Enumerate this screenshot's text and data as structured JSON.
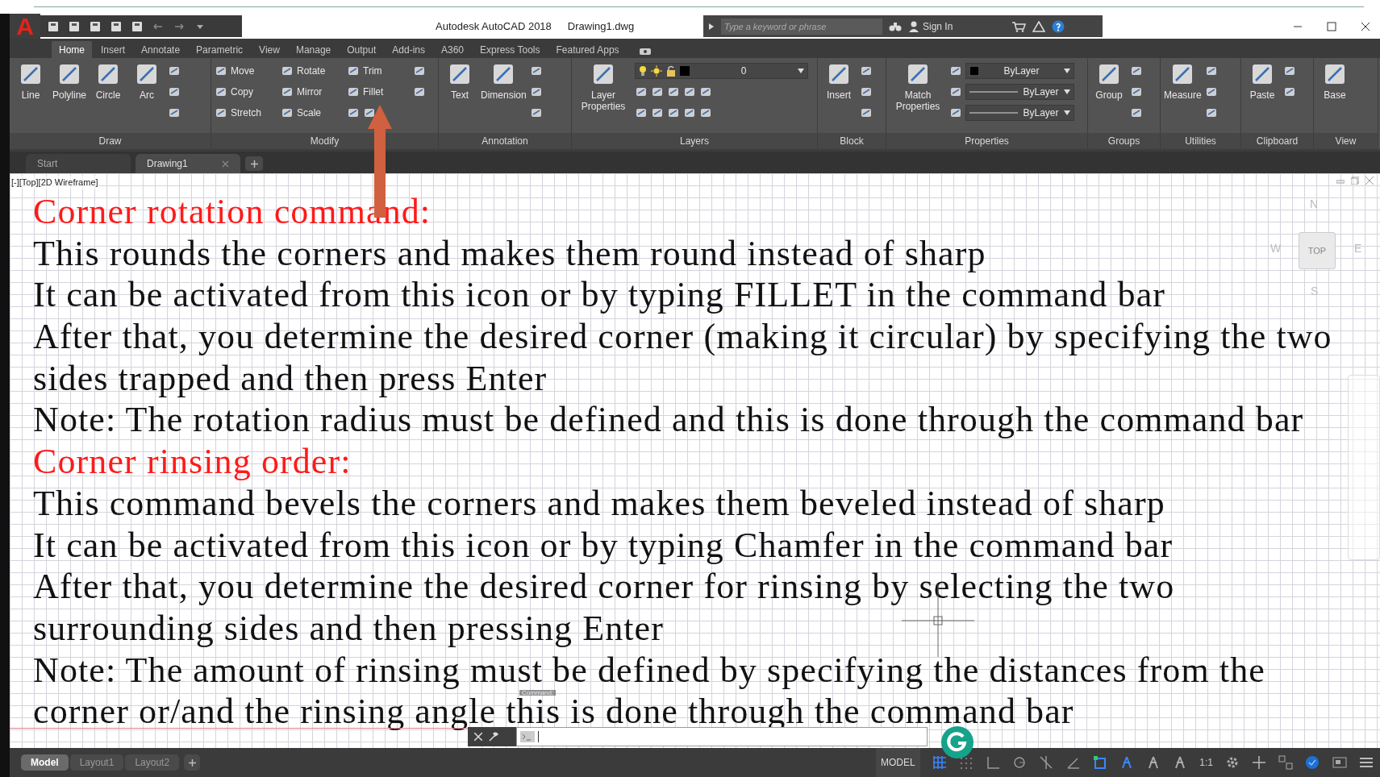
{
  "app_button": "A",
  "title": {
    "app": "Autodesk AutoCAD 2018",
    "file": "Drawing1.dwg"
  },
  "search": {
    "placeholder": "Type a keyword or phrase"
  },
  "sign_in": "Sign In",
  "ribbon_tabs": [
    {
      "label": "Home",
      "selected": true
    },
    {
      "label": "Insert",
      "selected": false
    },
    {
      "label": "Annotate",
      "selected": false
    },
    {
      "label": "Parametric",
      "selected": false
    },
    {
      "label": "View",
      "selected": false
    },
    {
      "label": "Manage",
      "selected": false
    },
    {
      "label": "Output",
      "selected": false
    },
    {
      "label": "Add-ins",
      "selected": false
    },
    {
      "label": "A360",
      "selected": false
    },
    {
      "label": "Express Tools",
      "selected": false
    },
    {
      "label": "Featured Apps",
      "selected": false
    }
  ],
  "ribbon_panels": [
    {
      "title": "Draw",
      "large": [
        "Line",
        "Polyline",
        "Circle",
        "Arc"
      ],
      "rows": [
        [
          {
            "kind": "icon"
          }
        ],
        [
          {
            "kind": "icon"
          }
        ],
        [
          {
            "kind": "icon"
          }
        ]
      ]
    },
    {
      "title": "Modify",
      "rows": [
        [
          {
            "kind": "small",
            "label": "Move"
          },
          {
            "kind": "small",
            "label": "Rotate"
          },
          {
            "kind": "small",
            "label": "Trim"
          },
          {
            "kind": "icon"
          }
        ],
        [
          {
            "kind": "small",
            "label": "Copy"
          },
          {
            "kind": "small",
            "label": "Mirror"
          },
          {
            "kind": "small",
            "label": "Fillet"
          },
          {
            "kind": "icon"
          }
        ],
        [
          {
            "kind": "small",
            "label": "Stretch"
          },
          {
            "kind": "small",
            "label": "Scale"
          },
          {
            "kind": "icon"
          },
          {
            "kind": "icon"
          }
        ]
      ]
    },
    {
      "title": "Annotation",
      "large": [
        "Text",
        "Dimension"
      ],
      "rows": [
        [
          {
            "kind": "icon"
          }
        ],
        [
          {
            "kind": "icon"
          }
        ],
        [
          {
            "kind": "icon"
          }
        ]
      ]
    },
    {
      "title": "Layers",
      "large": [
        "Layer Properties"
      ],
      "rows": [
        [
          {
            "kind": "layer",
            "label": "0"
          }
        ],
        [
          {
            "kind": "icon"
          },
          {
            "kind": "icon"
          },
          {
            "kind": "icon"
          },
          {
            "kind": "icon"
          },
          {
            "kind": "icon"
          }
        ],
        [
          {
            "kind": "icon"
          },
          {
            "kind": "icon"
          },
          {
            "kind": "icon"
          },
          {
            "kind": "icon"
          },
          {
            "kind": "icon"
          }
        ]
      ]
    },
    {
      "title": "Block",
      "large": [
        "Insert"
      ],
      "rows": [
        [
          {
            "kind": "icon"
          }
        ],
        [
          {
            "kind": "icon"
          }
        ],
        [
          {
            "kind": "icon"
          }
        ]
      ]
    },
    {
      "title": "Properties",
      "large": [
        "Match Properties"
      ],
      "rows": [
        [
          {
            "kind": "icon"
          },
          {
            "kind": "swatch",
            "label": "ByLayer"
          }
        ],
        [
          {
            "kind": "icon"
          },
          {
            "kind": "linetype",
            "label": "ByLayer"
          }
        ],
        [
          {
            "kind": "icon"
          },
          {
            "kind": "linetype",
            "label": "ByLayer"
          }
        ]
      ]
    },
    {
      "title": "Groups",
      "large": [
        "Group"
      ],
      "rows": [
        [
          {
            "kind": "icon"
          }
        ],
        [
          {
            "kind": "icon"
          }
        ],
        [
          {
            "kind": "icon"
          }
        ]
      ]
    },
    {
      "title": "Utilities",
      "large": [
        "Measure"
      ],
      "rows": [
        [
          {
            "kind": "icon"
          }
        ],
        [
          {
            "kind": "icon"
          }
        ],
        [
          {
            "kind": "icon"
          }
        ]
      ]
    },
    {
      "title": "Clipboard",
      "large": [
        "Paste"
      ],
      "rows": [
        [
          {
            "kind": "icon"
          }
        ],
        [
          {
            "kind": "icon"
          }
        ],
        []
      ]
    },
    {
      "title": "View",
      "large": [
        "Base"
      ]
    }
  ],
  "file_tabs": [
    {
      "label": "Start",
      "selected": false,
      "closable": false
    },
    {
      "label": "Drawing1",
      "selected": true,
      "closable": true
    }
  ],
  "viewport": {
    "label": "[-][Top][2D Wireframe]",
    "lines": [
      {
        "kind": "heading",
        "text": "Corner rotation command:"
      },
      {
        "kind": "body",
        "text": "This rounds the corners and makes them round instead of sharp"
      },
      {
        "kind": "body",
        "text": "It can be activated from this icon or by typing FILLET in the command bar"
      },
      {
        "kind": "body",
        "text": "After that, you determine the desired corner (making it circular) by specifying the two"
      },
      {
        "kind": "body",
        "text": "sides trapped and then press Enter"
      },
      {
        "kind": "body",
        "text": "Note: The rotation radius must be defined and this is done through the command bar"
      },
      {
        "kind": "heading",
        "text": "Corner rinsing order:"
      },
      {
        "kind": "body",
        "text": "This command bevels the corners and makes them beveled instead of sharp"
      },
      {
        "kind": "body",
        "text": "It can be activated from this icon or by typing Chamfer in the command bar"
      },
      {
        "kind": "body",
        "text": "After that, you determine the desired corner for rinsing by selecting the two"
      },
      {
        "kind": "body",
        "text": "surrounding sides and then pressing Enter"
      },
      {
        "kind": "body",
        "text": "Note: The amount of rinsing must be defined by specifying the distances from the"
      },
      {
        "kind": "body",
        "text": "corner or/and the rinsing angle this is done through the command bar"
      }
    ],
    "viewcube": {
      "north": "N",
      "west": "W",
      "top": "TOP",
      "east": "E",
      "south": "S"
    },
    "command_history": "Command:"
  },
  "layout_tabs": [
    {
      "label": "Model",
      "selected": true
    },
    {
      "label": "Layout1",
      "selected": false
    },
    {
      "label": "Layout2",
      "selected": false
    }
  ],
  "status": {
    "model": "MODEL",
    "scale": "1:1"
  }
}
